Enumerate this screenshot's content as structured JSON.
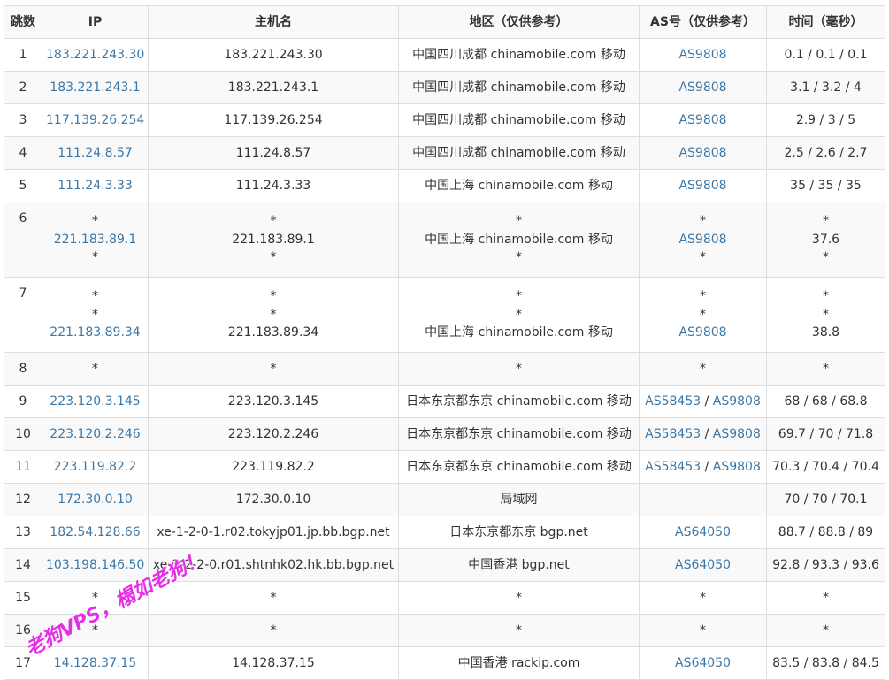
{
  "headers": {
    "hop": "跳数",
    "ip": "IP",
    "hostname": "主机名",
    "region": "地区（仅供参考）",
    "as": "AS号（仅供参考）",
    "time": "时间（毫秒）"
  },
  "rows": [
    {
      "hop": "1",
      "ip": [
        "183.221.243.30"
      ],
      "host": [
        "183.221.243.30"
      ],
      "region": [
        "中国四川成都 chinamobile.com 移动"
      ],
      "as": [
        [
          "AS9808"
        ]
      ],
      "time": [
        "0.1 / 0.1 / 0.1"
      ]
    },
    {
      "hop": "2",
      "ip": [
        "183.221.243.1"
      ],
      "host": [
        "183.221.243.1"
      ],
      "region": [
        "中国四川成都 chinamobile.com 移动"
      ],
      "as": [
        [
          "AS9808"
        ]
      ],
      "time": [
        "3.1 / 3.2 / 4"
      ]
    },
    {
      "hop": "3",
      "ip": [
        "117.139.26.254"
      ],
      "host": [
        "117.139.26.254"
      ],
      "region": [
        "中国四川成都 chinamobile.com 移动"
      ],
      "as": [
        [
          "AS9808"
        ]
      ],
      "time": [
        "2.9 / 3 / 5"
      ]
    },
    {
      "hop": "4",
      "ip": [
        "111.24.8.57"
      ],
      "host": [
        "111.24.8.57"
      ],
      "region": [
        "中国四川成都 chinamobile.com 移动"
      ],
      "as": [
        [
          "AS9808"
        ]
      ],
      "time": [
        "2.5 / 2.6 / 2.7"
      ]
    },
    {
      "hop": "5",
      "ip": [
        "111.24.3.33"
      ],
      "host": [
        "111.24.3.33"
      ],
      "region": [
        "中国上海 chinamobile.com 移动"
      ],
      "as": [
        [
          "AS9808"
        ]
      ],
      "time": [
        "35 / 35 / 35"
      ]
    },
    {
      "hop": "6",
      "ip": [
        "*",
        "221.183.89.1",
        "*"
      ],
      "host": [
        "*",
        "221.183.89.1",
        "*"
      ],
      "region": [
        "*",
        "中国上海 chinamobile.com 移动",
        "*"
      ],
      "as": [
        [
          "*"
        ],
        [
          "AS9808"
        ],
        [
          "*"
        ]
      ],
      "time": [
        "*",
        "37.6",
        "*"
      ]
    },
    {
      "hop": "7",
      "ip": [
        "*",
        "*",
        "221.183.89.34"
      ],
      "host": [
        "*",
        "*",
        "221.183.89.34"
      ],
      "region": [
        "*",
        "*",
        "中国上海 chinamobile.com 移动"
      ],
      "as": [
        [
          "*"
        ],
        [
          "*"
        ],
        [
          "AS9808"
        ]
      ],
      "time": [
        "*",
        "*",
        "38.8"
      ]
    },
    {
      "hop": "8",
      "ip": [
        "*"
      ],
      "host": [
        "*"
      ],
      "region": [
        "*"
      ],
      "as": [
        [
          "*"
        ]
      ],
      "time": [
        "*"
      ]
    },
    {
      "hop": "9",
      "ip": [
        "223.120.3.145"
      ],
      "host": [
        "223.120.3.145"
      ],
      "region": [
        "日本东京都东京 chinamobile.com 移动"
      ],
      "as": [
        [
          "AS58453",
          "AS9808"
        ]
      ],
      "time": [
        "68 / 68 / 68.8"
      ]
    },
    {
      "hop": "10",
      "ip": [
        "223.120.2.246"
      ],
      "host": [
        "223.120.2.246"
      ],
      "region": [
        "日本东京都东京 chinamobile.com 移动"
      ],
      "as": [
        [
          "AS58453",
          "AS9808"
        ]
      ],
      "time": [
        "69.7 / 70 / 71.8"
      ]
    },
    {
      "hop": "11",
      "ip": [
        "223.119.82.2"
      ],
      "host": [
        "223.119.82.2"
      ],
      "region": [
        "日本东京都东京 chinamobile.com 移动"
      ],
      "as": [
        [
          "AS58453",
          "AS9808"
        ]
      ],
      "time": [
        "70.3 / 70.4 / 70.4"
      ]
    },
    {
      "hop": "12",
      "ip": [
        "172.30.0.10"
      ],
      "host": [
        "172.30.0.10"
      ],
      "region": [
        "局域网"
      ],
      "as": [
        []
      ],
      "time": [
        "70 / 70 / 70.1"
      ]
    },
    {
      "hop": "13",
      "ip": [
        "182.54.128.66"
      ],
      "host": [
        "xe-1-2-0-1.r02.tokyjp01.jp.bb.bgp.net"
      ],
      "region": [
        "日本东京都东京 bgp.net"
      ],
      "as": [
        [
          "AS64050"
        ]
      ],
      "time": [
        "88.7 / 88.8 / 89"
      ]
    },
    {
      "hop": "14",
      "ip": [
        "103.198.146.50"
      ],
      "host": [
        "xe-3-2-2-0.r01.shtnhk02.hk.bb.bgp.net"
      ],
      "region": [
        "中国香港 bgp.net"
      ],
      "as": [
        [
          "AS64050"
        ]
      ],
      "time": [
        "92.8 / 93.3 / 93.6"
      ]
    },
    {
      "hop": "15",
      "ip": [
        "*"
      ],
      "host": [
        "*"
      ],
      "region": [
        "*"
      ],
      "as": [
        [
          "*"
        ]
      ],
      "time": [
        "*"
      ]
    },
    {
      "hop": "16",
      "ip": [
        "*"
      ],
      "host": [
        "*"
      ],
      "region": [
        "*"
      ],
      "as": [
        [
          "*"
        ]
      ],
      "time": [
        "*"
      ]
    },
    {
      "hop": "17",
      "ip": [
        "14.128.37.15"
      ],
      "host": [
        "14.128.37.15"
      ],
      "region": [
        "中国香港 rackip.com"
      ],
      "as": [
        [
          "AS64050"
        ]
      ],
      "time": [
        "83.5 / 83.8 / 84.5"
      ]
    }
  ],
  "as_separator": " / ",
  "watermark": "老狗VPS，榻如老狗！",
  "colors": {
    "link": "#3b78a8",
    "border": "#dddddd",
    "stripe": "#f9f9f9",
    "watermark": "#e62ee6"
  }
}
